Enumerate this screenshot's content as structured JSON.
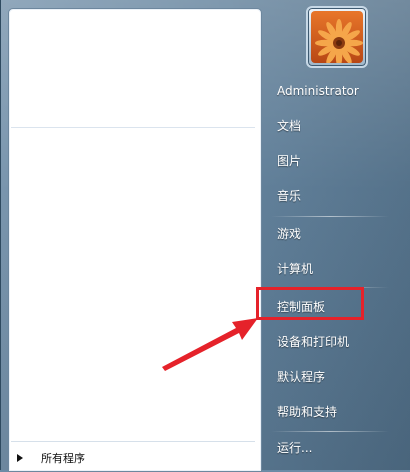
{
  "start_menu": {
    "all_programs": "所有程序",
    "right_items": [
      {
        "label": "Administrator"
      },
      {
        "label": "文档"
      },
      {
        "label": "图片"
      },
      {
        "label": "音乐"
      },
      {
        "label": "游戏"
      },
      {
        "label": "计算机"
      },
      {
        "label": "控制面板"
      },
      {
        "label": "设备和打印机"
      },
      {
        "label": "默认程序"
      },
      {
        "label": "帮助和支持"
      },
      {
        "label": "运行..."
      }
    ]
  },
  "annotation": {
    "highlight_color": "#e5222a",
    "highlighted_item": "控制面板"
  }
}
